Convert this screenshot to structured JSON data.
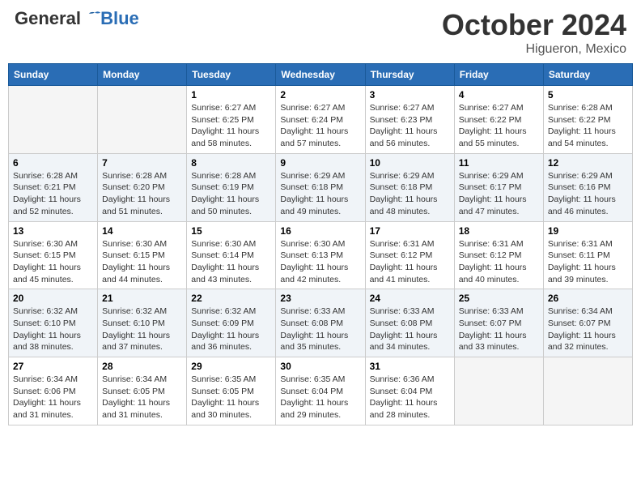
{
  "header": {
    "logo_general": "General",
    "logo_blue": "Blue",
    "month": "October 2024",
    "location": "Higueron, Mexico"
  },
  "weekdays": [
    "Sunday",
    "Monday",
    "Tuesday",
    "Wednesday",
    "Thursday",
    "Friday",
    "Saturday"
  ],
  "weeks": [
    [
      {
        "day": "",
        "info": ""
      },
      {
        "day": "",
        "info": ""
      },
      {
        "day": "1",
        "info": "Sunrise: 6:27 AM\nSunset: 6:25 PM\nDaylight: 11 hours and 58 minutes."
      },
      {
        "day": "2",
        "info": "Sunrise: 6:27 AM\nSunset: 6:24 PM\nDaylight: 11 hours and 57 minutes."
      },
      {
        "day": "3",
        "info": "Sunrise: 6:27 AM\nSunset: 6:23 PM\nDaylight: 11 hours and 56 minutes."
      },
      {
        "day": "4",
        "info": "Sunrise: 6:27 AM\nSunset: 6:22 PM\nDaylight: 11 hours and 55 minutes."
      },
      {
        "day": "5",
        "info": "Sunrise: 6:28 AM\nSunset: 6:22 PM\nDaylight: 11 hours and 54 minutes."
      }
    ],
    [
      {
        "day": "6",
        "info": "Sunrise: 6:28 AM\nSunset: 6:21 PM\nDaylight: 11 hours and 52 minutes."
      },
      {
        "day": "7",
        "info": "Sunrise: 6:28 AM\nSunset: 6:20 PM\nDaylight: 11 hours and 51 minutes."
      },
      {
        "day": "8",
        "info": "Sunrise: 6:28 AM\nSunset: 6:19 PM\nDaylight: 11 hours and 50 minutes."
      },
      {
        "day": "9",
        "info": "Sunrise: 6:29 AM\nSunset: 6:18 PM\nDaylight: 11 hours and 49 minutes."
      },
      {
        "day": "10",
        "info": "Sunrise: 6:29 AM\nSunset: 6:18 PM\nDaylight: 11 hours and 48 minutes."
      },
      {
        "day": "11",
        "info": "Sunrise: 6:29 AM\nSunset: 6:17 PM\nDaylight: 11 hours and 47 minutes."
      },
      {
        "day": "12",
        "info": "Sunrise: 6:29 AM\nSunset: 6:16 PM\nDaylight: 11 hours and 46 minutes."
      }
    ],
    [
      {
        "day": "13",
        "info": "Sunrise: 6:30 AM\nSunset: 6:15 PM\nDaylight: 11 hours and 45 minutes."
      },
      {
        "day": "14",
        "info": "Sunrise: 6:30 AM\nSunset: 6:15 PM\nDaylight: 11 hours and 44 minutes."
      },
      {
        "day": "15",
        "info": "Sunrise: 6:30 AM\nSunset: 6:14 PM\nDaylight: 11 hours and 43 minutes."
      },
      {
        "day": "16",
        "info": "Sunrise: 6:30 AM\nSunset: 6:13 PM\nDaylight: 11 hours and 42 minutes."
      },
      {
        "day": "17",
        "info": "Sunrise: 6:31 AM\nSunset: 6:12 PM\nDaylight: 11 hours and 41 minutes."
      },
      {
        "day": "18",
        "info": "Sunrise: 6:31 AM\nSunset: 6:12 PM\nDaylight: 11 hours and 40 minutes."
      },
      {
        "day": "19",
        "info": "Sunrise: 6:31 AM\nSunset: 6:11 PM\nDaylight: 11 hours and 39 minutes."
      }
    ],
    [
      {
        "day": "20",
        "info": "Sunrise: 6:32 AM\nSunset: 6:10 PM\nDaylight: 11 hours and 38 minutes."
      },
      {
        "day": "21",
        "info": "Sunrise: 6:32 AM\nSunset: 6:10 PM\nDaylight: 11 hours and 37 minutes."
      },
      {
        "day": "22",
        "info": "Sunrise: 6:32 AM\nSunset: 6:09 PM\nDaylight: 11 hours and 36 minutes."
      },
      {
        "day": "23",
        "info": "Sunrise: 6:33 AM\nSunset: 6:08 PM\nDaylight: 11 hours and 35 minutes."
      },
      {
        "day": "24",
        "info": "Sunrise: 6:33 AM\nSunset: 6:08 PM\nDaylight: 11 hours and 34 minutes."
      },
      {
        "day": "25",
        "info": "Sunrise: 6:33 AM\nSunset: 6:07 PM\nDaylight: 11 hours and 33 minutes."
      },
      {
        "day": "26",
        "info": "Sunrise: 6:34 AM\nSunset: 6:07 PM\nDaylight: 11 hours and 32 minutes."
      }
    ],
    [
      {
        "day": "27",
        "info": "Sunrise: 6:34 AM\nSunset: 6:06 PM\nDaylight: 11 hours and 31 minutes."
      },
      {
        "day": "28",
        "info": "Sunrise: 6:34 AM\nSunset: 6:05 PM\nDaylight: 11 hours and 31 minutes."
      },
      {
        "day": "29",
        "info": "Sunrise: 6:35 AM\nSunset: 6:05 PM\nDaylight: 11 hours and 30 minutes."
      },
      {
        "day": "30",
        "info": "Sunrise: 6:35 AM\nSunset: 6:04 PM\nDaylight: 11 hours and 29 minutes."
      },
      {
        "day": "31",
        "info": "Sunrise: 6:36 AM\nSunset: 6:04 PM\nDaylight: 11 hours and 28 minutes."
      },
      {
        "day": "",
        "info": ""
      },
      {
        "day": "",
        "info": ""
      }
    ]
  ]
}
